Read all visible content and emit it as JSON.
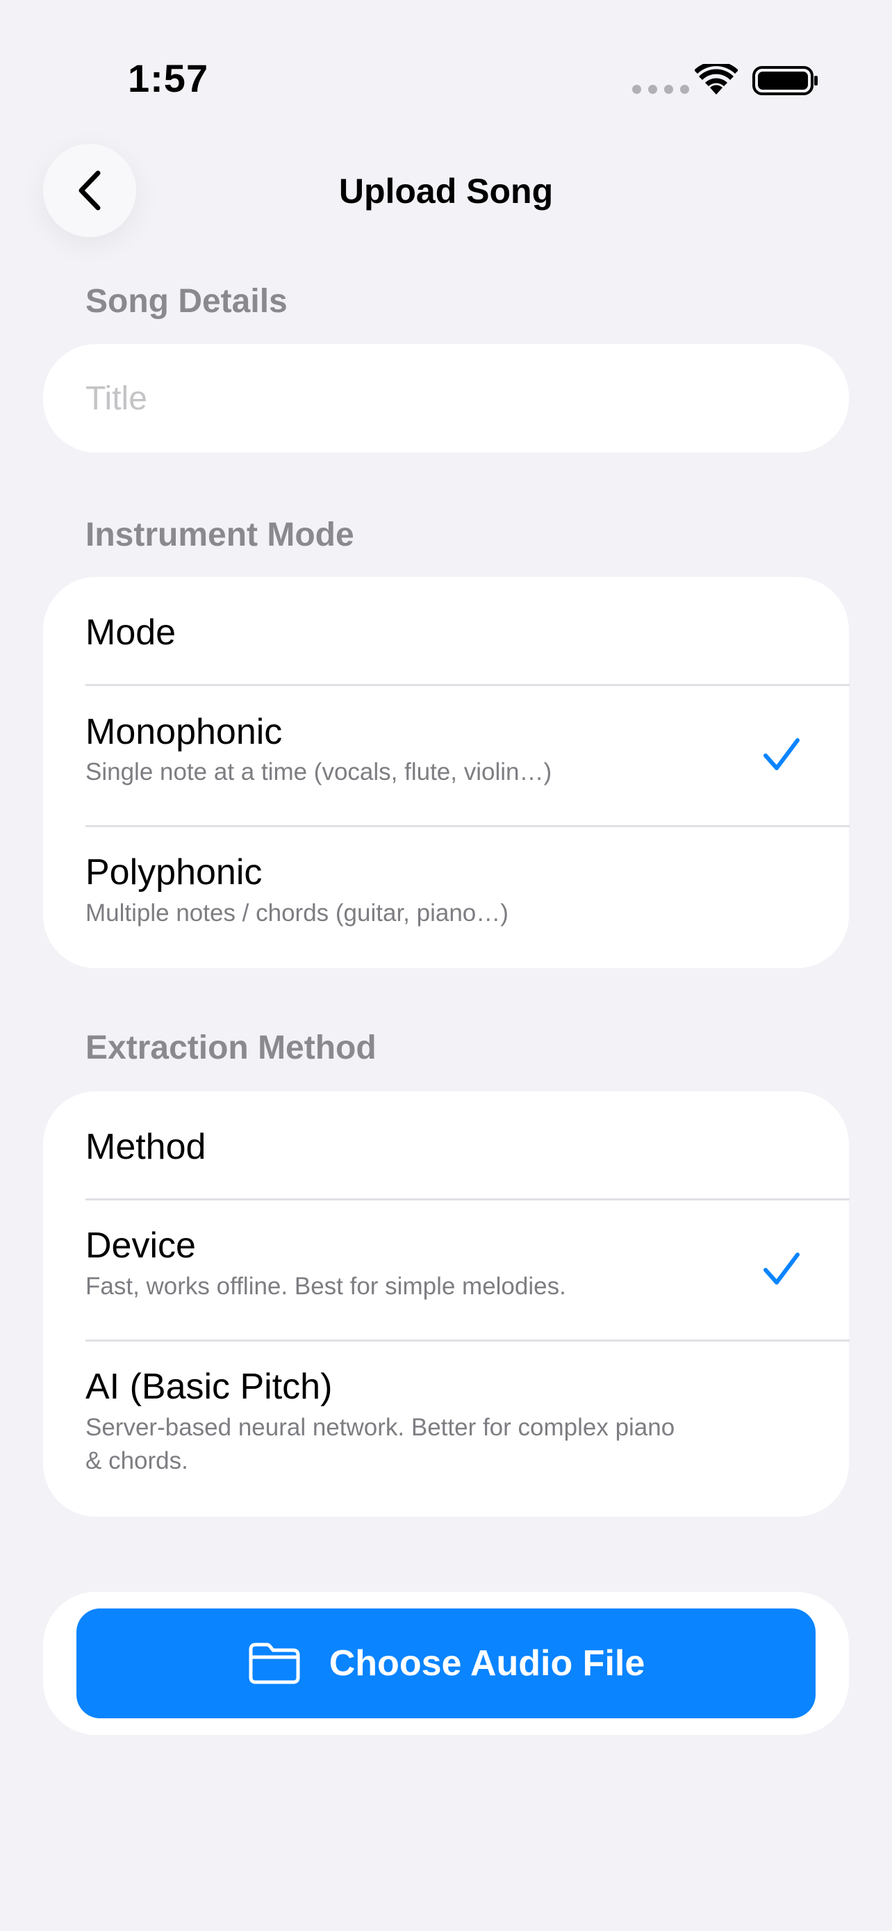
{
  "status_bar": {
    "time": "1:57"
  },
  "nav": {
    "title": "Upload Song",
    "back_icon": "chevron-left-icon"
  },
  "song_details": {
    "header": "Song Details",
    "title_placeholder": "Title",
    "title_value": ""
  },
  "instrument_mode": {
    "header": "Instrument Mode",
    "picker_label": "Mode",
    "options": [
      {
        "label": "Monophonic",
        "subtitle": "Single note at a time (vocals, flute, violin…)",
        "selected": true
      },
      {
        "label": "Polyphonic",
        "subtitle": "Multiple notes / chords (guitar, piano…)",
        "selected": false
      }
    ]
  },
  "extraction_method": {
    "header": "Extraction Method",
    "picker_label": "Method",
    "options": [
      {
        "label": "Device",
        "subtitle": "Fast, works offline. Best for simple melodies.",
        "selected": true
      },
      {
        "label": "AI (Basic Pitch)",
        "subtitle": "Server-based neural network. Better for complex piano & chords.",
        "selected": false
      }
    ]
  },
  "upload": {
    "button_label": "Choose Audio File",
    "icon": "folder-icon"
  },
  "colors": {
    "accent": "#0A84FF",
    "background": "#F2F2F7",
    "section_header": "#8A8A8E"
  }
}
